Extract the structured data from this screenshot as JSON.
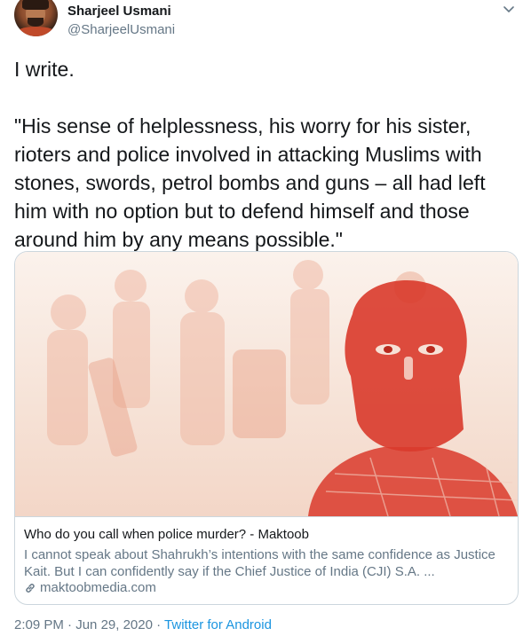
{
  "author": {
    "name": "Sharjeel Usmani",
    "handle": "@SharjeelUsmani"
  },
  "tweet": {
    "text": "I write.\n\n\"His sense of helplessness, his worry for his sister, rioters and police involved in attacking Muslims with stones, swords, petrol bombs and guns – all had left him with no option but to defend himself and those around him by any means possible.\""
  },
  "card": {
    "title": "Who do you call when police murder? - Maktoob",
    "description": "I cannot speak about Shahrukh’s intentions with the same confidence as Justice Kait. But I can confidently say if the Chief Justice of India (CJI) S.A. ...",
    "domain": "maktoobmedia.com"
  },
  "footer": {
    "time": "2:09 PM",
    "separator1": " · ",
    "date": "Jun 29, 2020",
    "separator2": " · ",
    "source": "Twitter for Android"
  },
  "icons": {
    "menu": "chevron-down-icon",
    "link": "link-icon"
  },
  "colors": {
    "link": "#1b95e0",
    "secondary_text": "#657786",
    "illustration_red": "#d93a2b"
  }
}
